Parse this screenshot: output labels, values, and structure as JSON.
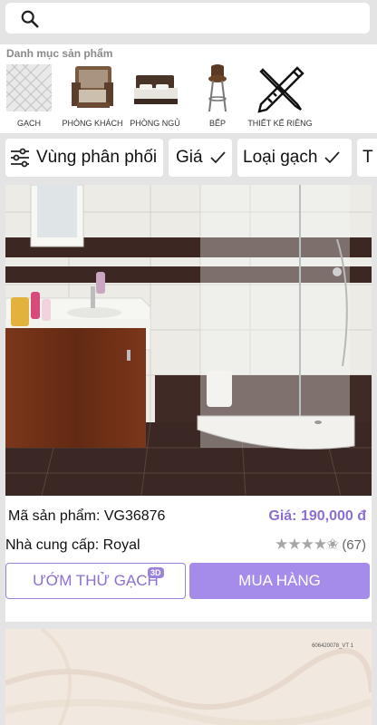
{
  "search": {
    "placeholder": ""
  },
  "categories": {
    "title": "Danh mục sản phẩm",
    "items": [
      {
        "label": "GẠCH",
        "icon": "tile-icon"
      },
      {
        "label": "PHÒNG KHÁCH",
        "icon": "armchair-icon"
      },
      {
        "label": "PHÒNG NGỦ",
        "icon": "bed-icon"
      },
      {
        "label": "BẾP",
        "icon": "bar-stool-icon"
      },
      {
        "label": "THIẾT KẾ RIÊNG",
        "icon": "design-tools-icon"
      }
    ]
  },
  "filters": {
    "items": [
      {
        "label": "Vùng phân phối",
        "icon": "sliders-icon"
      },
      {
        "label": "Giá",
        "icon": "check-icon"
      },
      {
        "label": "Loại gạch",
        "icon": "check-icon"
      },
      {
        "label": "T"
      }
    ]
  },
  "product": {
    "code_label": "Mã sản phẩm: VG36876",
    "price": "Giá: 190,000 đ",
    "supplier_label": "Nhà cung cấp: Royal",
    "rating": 4.5,
    "stars": "★★★★✬",
    "review_count": "(67)",
    "try_button": "ƯỚM THỬ GẠCH",
    "badge_3d": "3D",
    "buy_button": "MUA HÀNG",
    "colors": {
      "accent": "#8c6fd1",
      "button": "#a58bea"
    }
  },
  "next_card": {
    "code": "606420078_VT 1"
  }
}
